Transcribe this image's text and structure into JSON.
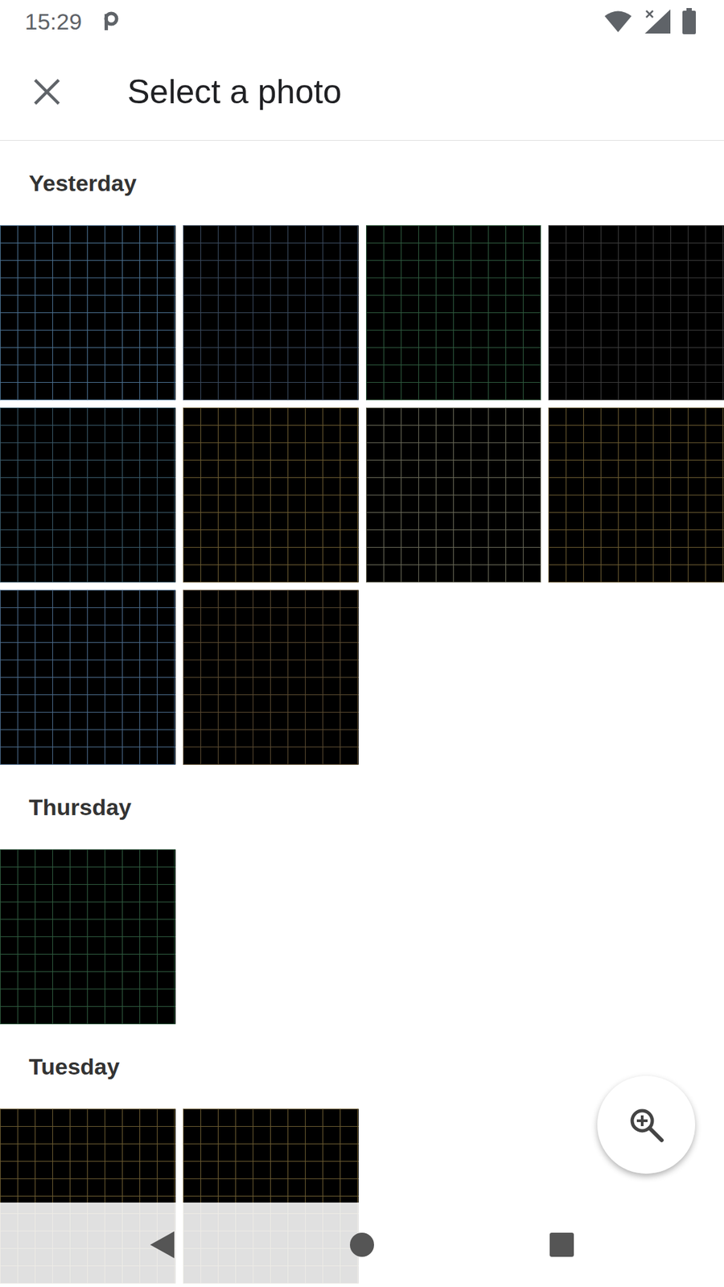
{
  "status_bar": {
    "time": "15:29"
  },
  "app_bar": {
    "title": "Select a photo"
  },
  "sections": [
    {
      "label": "Yesterday",
      "photos": [
        {
          "color": "#4a7090"
        },
        {
          "color": "#3a4a5e"
        },
        {
          "color": "#2e5a3e"
        },
        {
          "color": "#3c3c3c"
        },
        {
          "color": "#3a5a6a"
        },
        {
          "color": "#6a5a30"
        },
        {
          "color": "#6a6a58"
        },
        {
          "color": "#6a5a30"
        },
        {
          "color": "#4a6a8a"
        },
        {
          "color": "#5a4a30"
        }
      ]
    },
    {
      "label": "Thursday",
      "photos": [
        {
          "color": "#2e5a3e"
        }
      ]
    },
    {
      "label": "Tuesday",
      "photos": [
        {
          "color": "#6a5a30"
        },
        {
          "color": "#6a5a30"
        }
      ]
    }
  ]
}
